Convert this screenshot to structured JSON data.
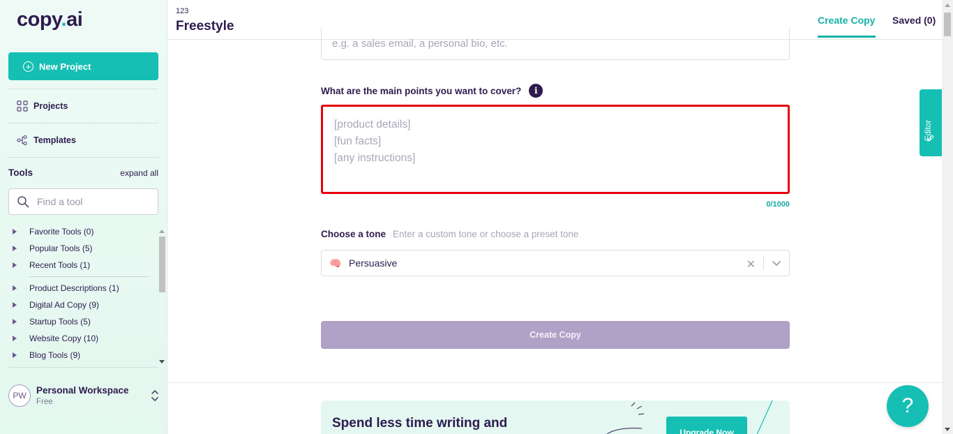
{
  "app": {
    "logo_main": "copy",
    "logo_dot": ".",
    "logo_tail": "ai"
  },
  "sidebar": {
    "new_project_label": "New Project",
    "nav": [
      {
        "label": "Projects",
        "icon": "grid-icon"
      },
      {
        "label": "Templates",
        "icon": "templates-icon"
      }
    ],
    "tools_title": "Tools",
    "expand_all": "expand all",
    "search_placeholder": "Find a tool",
    "tool_groups": [
      "Favorite Tools (0)",
      "Popular Tools (5)",
      "Recent Tools (1)",
      "Product Descriptions (1)",
      "Digital Ad Copy (9)",
      "Startup Tools (5)",
      "Website Copy (10)",
      "Blog Tools (9)"
    ],
    "workspace": {
      "initials": "PW",
      "name": "Personal Workspace",
      "plan": "Free"
    }
  },
  "header": {
    "project_id": "123",
    "project_title": "Freestyle",
    "tabs": {
      "create": "Create Copy",
      "saved": "Saved (0)"
    }
  },
  "form": {
    "top_placeholder": "e.g. a sales email, a personal bio, etc.",
    "points_label": "What are the main points you want to cover?",
    "info_icon_glyph": "i",
    "points_placeholder": "[product details]\n[fun facts]\n[any instructions]",
    "counter": "0/1000",
    "tone_label": "Choose a tone",
    "tone_hint": "Enter a custom tone or choose a preset tone",
    "tone_value": "Persuasive",
    "tone_emoji": "🧠",
    "create_button": "Create Copy"
  },
  "promo": {
    "text": "Spend less time writing and",
    "button": "Upgrade Now"
  },
  "editor_tab": "Editor",
  "help_glyph": "?",
  "colors": {
    "accent": "#16bfb3",
    "text": "#2d1b4e",
    "highlight": "#e8000b",
    "disabled_button": "#b0a2c6"
  }
}
